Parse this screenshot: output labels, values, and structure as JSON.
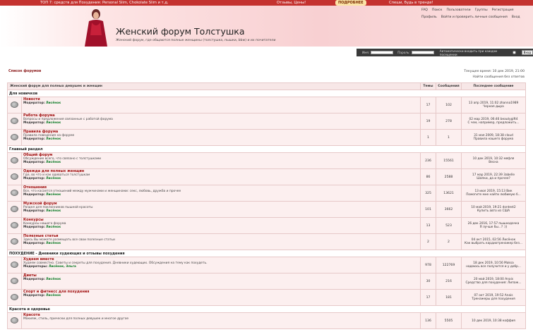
{
  "topbar": {
    "promo": "ТОП 7: средств для Похудения: Personal Slim, Chokolate Slim и т.д.",
    "reviews": "Отзывы, Цены!",
    "more_btn": "ПОДРОБНЕЕ",
    "slogan": "Спеши, будь в тренде!"
  },
  "header": {
    "title": "Женский форум Толстушка",
    "subtitle": "Женский форум, где общаются полные женщины (толстушка, пышки, bbw) и их почитатели"
  },
  "links": {
    "faq": "FAQ",
    "search": "Поиск",
    "users": "Пользователи",
    "groups": "Группы",
    "register": "Регистрация",
    "profile": "Профиль",
    "login_check": "Войти и проверить личные сообщения",
    "login": "Вход"
  },
  "loginbar": {
    "name_label": "Имя:",
    "pass_label": "Пароль:",
    "auto_label": "Автоматически входить при каждом посещении",
    "submit": "Вход"
  },
  "crumb": "Список форумов",
  "time": "Текущее время: 10 дек 2019, 21:00",
  "unread": "Найти сообщения без ответов",
  "columns": {
    "forum": "Женский форум для полных девушек и женщин",
    "topics": "Темы",
    "posts": "Сообщения",
    "last": "Последнее сообщение"
  },
  "mod_label": "Модератор:",
  "mods_label": "Модераторы:",
  "categories": [
    {
      "name": "Для новичков",
      "forums": [
        {
          "name": "Новости",
          "desc": "",
          "mod": "Лисёнок",
          "topics": "17",
          "posts": "102",
          "last1": "13 апр 2019, 11:02 zhannа1989",
          "last2": "Черная дыра"
        },
        {
          "name": "Работа форума",
          "desc": "Вопросы и предложения связанные с работой форума",
          "mod": "Лисёнок",
          "topics": "19",
          "posts": "278",
          "last1": "02 мар 2019, 06:46 beautygift4",
          "last2": "С чем, например, предложить..."
        },
        {
          "name": "Правила форума",
          "desc": "Правила поведения на форуме",
          "mod": "Лисёнок",
          "topics": "1",
          "posts": "1",
          "last1": "31 мая 2009, 18:38 cloud",
          "last2": "Правила нашего форума"
        }
      ]
    },
    {
      "name": "Главный раздел",
      "forums": [
        {
          "name": "Общий форум",
          "desc": "Обсуждение всего, что связано с толстушками",
          "mod": "Лисёнок",
          "topics": "236",
          "posts": "15561",
          "last1": "10 дек 2019, 10:32 мяфля",
          "last2": "Весна"
        },
        {
          "name": "Одежда для полных женщин",
          "desc": "Где, во что и как одеваться толстушкам",
          "mod": "Лисёнок",
          "topics": "86",
          "posts": "2588",
          "last1": "17 мар 2019, 22:39 3abelle",
          "last2": "Шапки, да и прочее?"
        },
        {
          "name": "Отношения",
          "desc": "Все, что касается отношений между мужчинами и женщинами: секс, любовь, дружба и прочее",
          "mod": "Лисёнок",
          "topics": "325",
          "posts": "13621",
          "last1": "13 июл 2019, 15:13 Вик",
          "last2": "Помогите мне найти любимую б..."
        },
        {
          "name": "Мужской форум",
          "desc": "Раздел для поклонников пышной красоты",
          "mod": "Лисёнок",
          "topics": "101",
          "posts": "3662",
          "last1": "10 май 2019, 19:21 dontest2",
          "last2": "Купить авто из США"
        },
        {
          "name": "Конкурсы",
          "desc": "Конкурсы нашего форума",
          "mod": "Лисёнок",
          "topics": "13",
          "posts": "523",
          "last1": "26 дек 2016, 17:57 пышнодачка",
          "last2": "Я лучше бы...? :))"
        },
        {
          "name": "Полезные статьи",
          "desc": "Здесь Вы можете размещать все свои полезные статьи",
          "mod": "Лисёнок",
          "topics": "2",
          "posts": "2",
          "last1": "04 окт 2015, 02:56 Лисёнок",
          "last2": "Как выбрать кардиотренажер без..."
        }
      ]
    },
    {
      "name": "ПОХУДЕНИЕ - Дневники худеющих и отзывы похудения",
      "forums": [
        {
          "name": "Худеем вместе",
          "desc": "Худеем совместно. Советы и секреты для похудения. Дневники худеющих. Обсуждения на тему как похудеть.",
          "mod": "Лисёнок, Эльга",
          "mods": true,
          "topics": "978",
          "posts": "122769",
          "last1": "18 дек 2019, 10:56 Maksa",
          "last2": "надеюсь все получится и у добр..."
        },
        {
          "name": "Диеты",
          "desc": "",
          "mod": "Лисёнок",
          "topics": "30",
          "posts": "216",
          "last1": "20 май 2019, 18:00 Anais",
          "last2": "Средство для похудения: Липаж..."
        },
        {
          "name": "Спорт и фитнесс для похудения",
          "desc": "",
          "mod": "Лисёнок",
          "topics": "17",
          "posts": "181",
          "last1": "07 окт 2019, 19:52 Anais",
          "last2": "Тренажеры для похудения"
        }
      ]
    },
    {
      "name": "Красота и здоровье",
      "forums": [
        {
          "name": "Красота",
          "desc": "Макияж, стиль, прически для полных девушек и многое другое",
          "mod": "",
          "topics": "136",
          "posts": "5505",
          "last1": "10 дек 2019, 10:38 коффия",
          "last2": ""
        }
      ]
    }
  ]
}
